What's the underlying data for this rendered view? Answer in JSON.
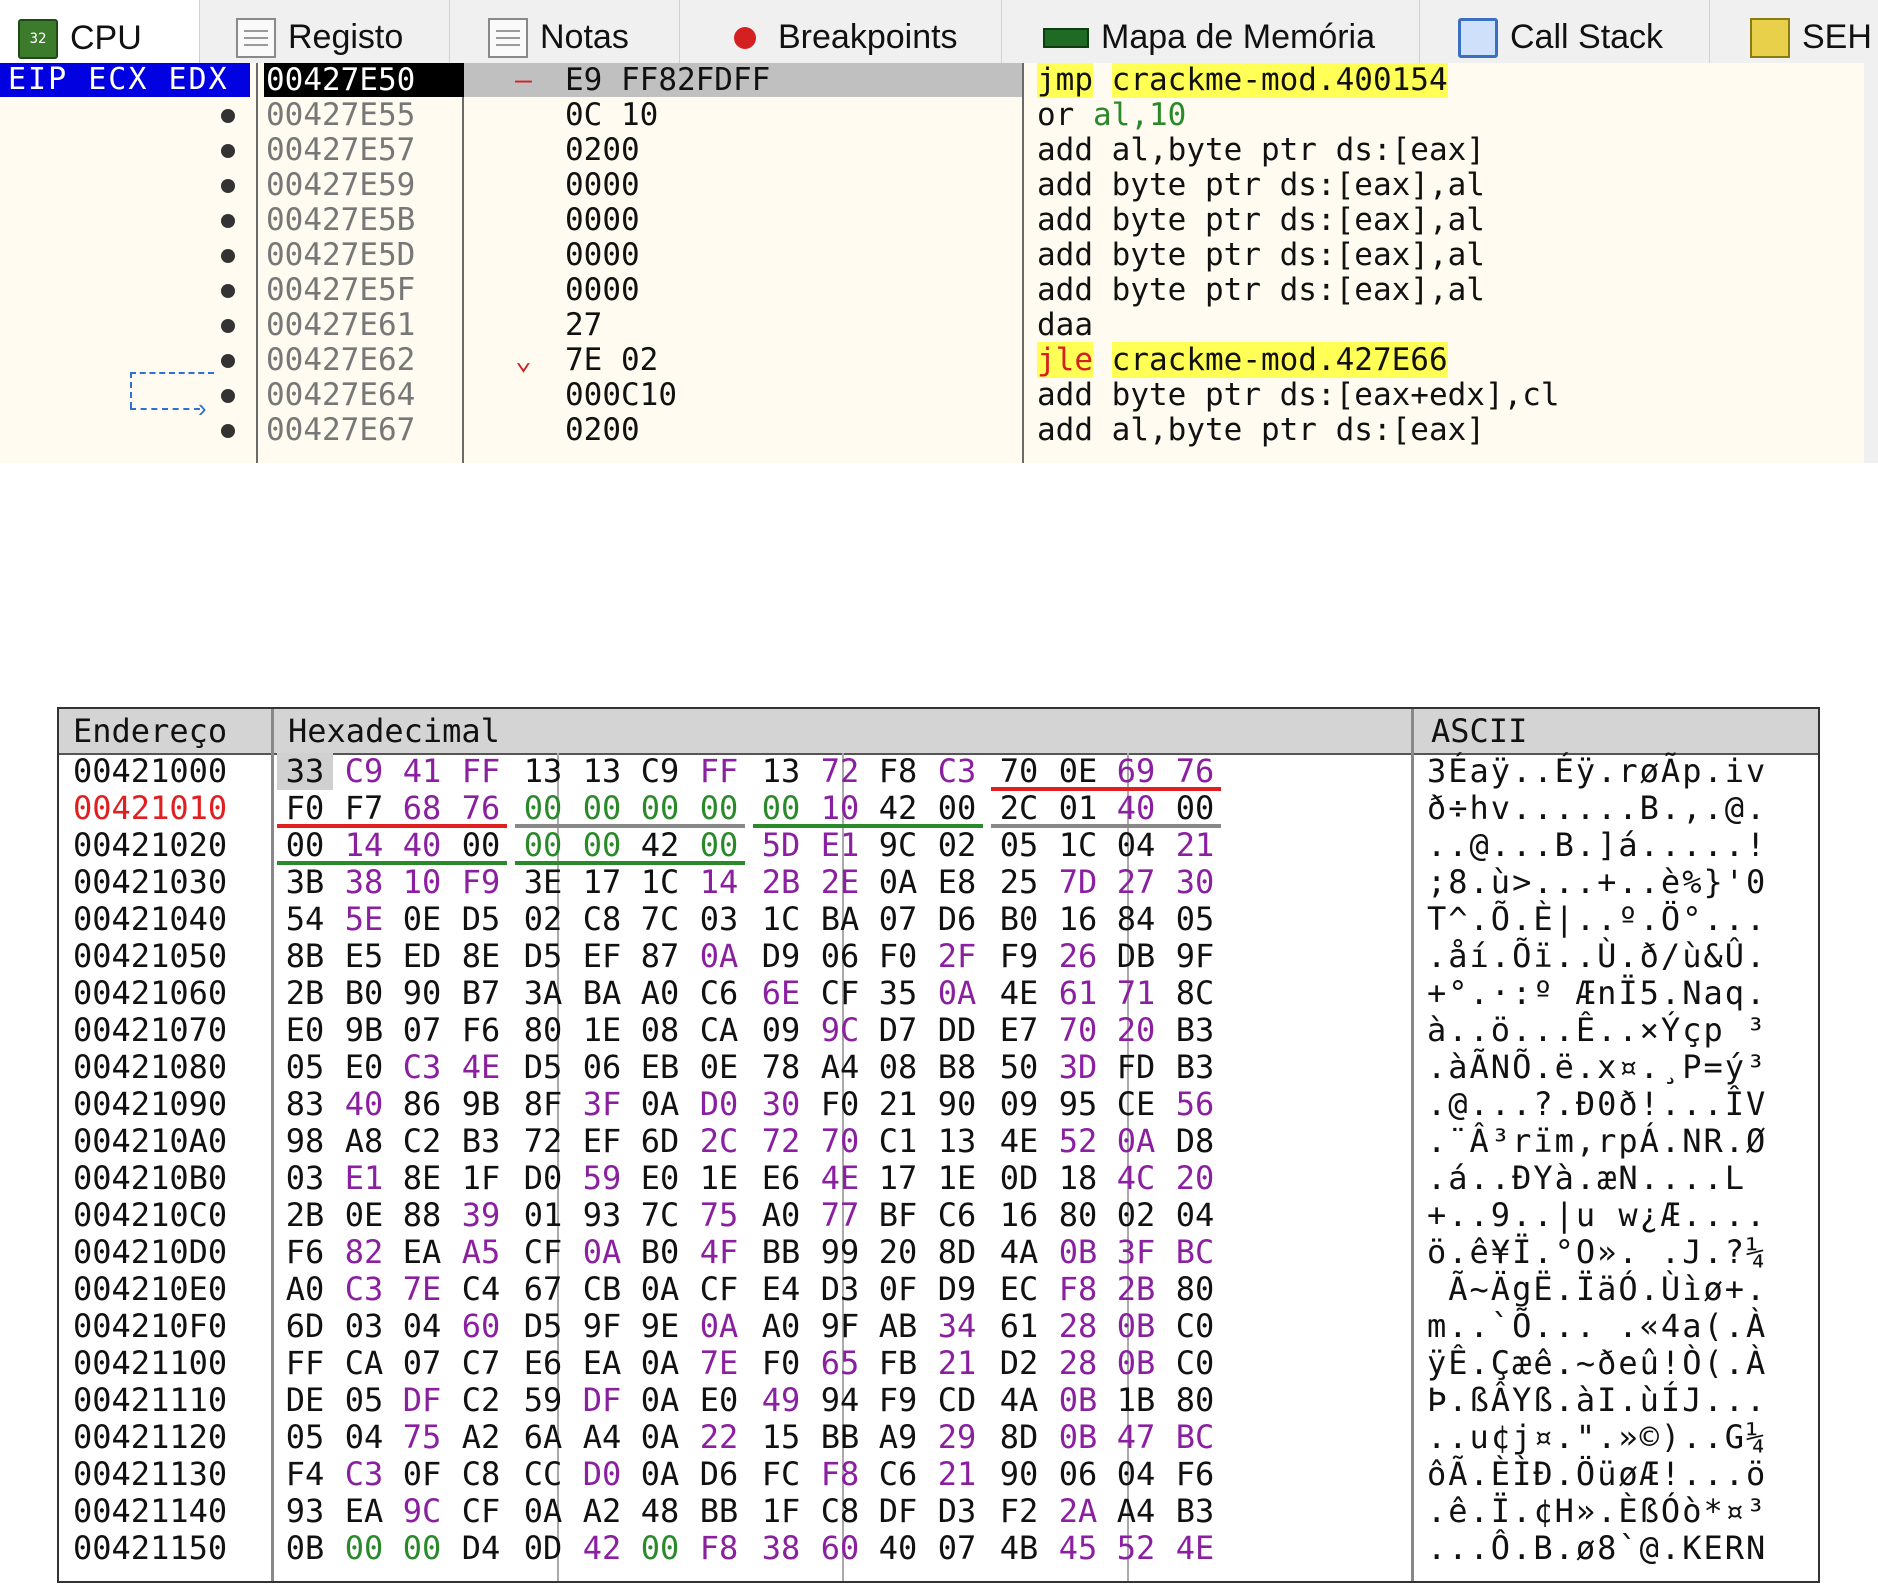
{
  "tabs": [
    {
      "label": "CPU",
      "icon": "cpu-32-icon",
      "active": true
    },
    {
      "label": "Registo",
      "icon": "log-icon"
    },
    {
      "label": "Notas",
      "icon": "notes-icon"
    },
    {
      "label": "Breakpoints",
      "icon": "breakpoint-icon"
    },
    {
      "label": "Mapa de Memória",
      "icon": "memory-map-icon"
    },
    {
      "label": "Call Stack",
      "icon": "call-stack-icon"
    },
    {
      "label": "SEH",
      "icon": "seh-icon"
    }
  ],
  "disasm": {
    "registers_label": "EIP ECX EDX",
    "rows": [
      {
        "addr": "00427E50",
        "bytes": "E9 FF82FDFF",
        "mnemonic": "jmp",
        "operands": "crackme-mod.400154",
        "current": true
      },
      {
        "addr": "00427E55",
        "bytes": "0C 10",
        "mnemonic": "or",
        "operands": "al,10"
      },
      {
        "addr": "00427E57",
        "bytes": "0200",
        "mnemonic": "add",
        "operands": "al,byte ptr ds:[eax]"
      },
      {
        "addr": "00427E59",
        "bytes": "0000",
        "mnemonic": "add",
        "operands": "byte ptr ds:[eax],al"
      },
      {
        "addr": "00427E5B",
        "bytes": "0000",
        "mnemonic": "add",
        "operands": "byte ptr ds:[eax],al"
      },
      {
        "addr": "00427E5D",
        "bytes": "0000",
        "mnemonic": "add",
        "operands": "byte ptr ds:[eax],al"
      },
      {
        "addr": "00427E5F",
        "bytes": "0000",
        "mnemonic": "add",
        "operands": "byte ptr ds:[eax],al"
      },
      {
        "addr": "00427E61",
        "bytes": "27",
        "mnemonic": "daa",
        "operands": ""
      },
      {
        "addr": "00427E62",
        "bytes": "7E 02",
        "mnemonic": "jle",
        "operands": "crackme-mod.427E66"
      },
      {
        "addr": "00427E64",
        "bytes": "000C10",
        "mnemonic": "add",
        "operands": "byte ptr ds:[eax+edx],cl"
      },
      {
        "addr": "00427E67",
        "bytes": "0200",
        "mnemonic": "add",
        "operands": "al,byte ptr ds:[eax]"
      }
    ]
  },
  "dump": {
    "headers": {
      "address": "Endereço",
      "hex": "Hexadecimal",
      "ascii": "ASCII"
    },
    "rows": [
      {
        "addr": "00421000",
        "bytes": [
          "33",
          "C9",
          "41",
          "FF",
          "13",
          "13",
          "C9",
          "FF",
          "13",
          "72",
          "F8",
          "C3",
          "70",
          "0E",
          "69",
          "76"
        ],
        "ascii": "3Éaÿ..Éÿ.røÃp.iv"
      },
      {
        "addr": "00421010",
        "bytes": [
          "F0",
          "F7",
          "68",
          "76",
          "00",
          "00",
          "00",
          "00",
          "00",
          "10",
          "42",
          "00",
          "2C",
          "01",
          "40",
          "00"
        ],
        "ascii": "ð÷hv......B.,.@.",
        "red": true
      },
      {
        "addr": "00421020",
        "bytes": [
          "00",
          "14",
          "40",
          "00",
          "00",
          "00",
          "42",
          "00",
          "5D",
          "E1",
          "9C",
          "02",
          "05",
          "1C",
          "04",
          "21"
        ],
        "ascii": "..@...B.]á.....!"
      },
      {
        "addr": "00421030",
        "bytes": [
          "3B",
          "38",
          "10",
          "F9",
          "3E",
          "17",
          "1C",
          "14",
          "2B",
          "2E",
          "0A",
          "E8",
          "25",
          "7D",
          "27",
          "30"
        ],
        "ascii": ";8.ù>...+..è%}'0"
      },
      {
        "addr": "00421040",
        "bytes": [
          "54",
          "5E",
          "0E",
          "D5",
          "02",
          "C8",
          "7C",
          "03",
          "1C",
          "BA",
          "07",
          "D6",
          "B0",
          "16",
          "84",
          "05"
        ],
        "ascii": "T^.Õ.È|..º.Ö°..."
      },
      {
        "addr": "00421050",
        "bytes": [
          "8B",
          "E5",
          "ED",
          "8E",
          "D5",
          "EF",
          "87",
          "0A",
          "D9",
          "06",
          "F0",
          "2F",
          "F9",
          "26",
          "DB",
          "9F"
        ],
        "ascii": ".åí.Õï..Ù.ð/ù&Û."
      },
      {
        "addr": "00421060",
        "bytes": [
          "2B",
          "B0",
          "90",
          "B7",
          "3A",
          "BA",
          "A0",
          "C6",
          "6E",
          "CF",
          "35",
          "0A",
          "4E",
          "61",
          "71",
          "8C"
        ],
        "ascii": "+°.·:º ÆnÏ5.Naq."
      },
      {
        "addr": "00421070",
        "bytes": [
          "E0",
          "9B",
          "07",
          "F6",
          "80",
          "1E",
          "08",
          "CA",
          "09",
          "9C",
          "D7",
          "DD",
          "E7",
          "70",
          "20",
          "B3"
        ],
        "ascii": "à..ö...Ê..×Ýçp ³"
      },
      {
        "addr": "00421080",
        "bytes": [
          "05",
          "E0",
          "C3",
          "4E",
          "D5",
          "06",
          "EB",
          "0E",
          "78",
          "A4",
          "08",
          "B8",
          "50",
          "3D",
          "FD",
          "B3"
        ],
        "ascii": ".àÃNÕ.ë.x¤.¸P=ý³"
      },
      {
        "addr": "00421090",
        "bytes": [
          "83",
          "40",
          "86",
          "9B",
          "8F",
          "3F",
          "0A",
          "D0",
          "30",
          "F0",
          "21",
          "90",
          "09",
          "95",
          "CE",
          "56"
        ],
        "ascii": ".@...?.Ð0ð!...ÎV"
      },
      {
        "addr": "004210A0",
        "bytes": [
          "98",
          "A8",
          "C2",
          "B3",
          "72",
          "EF",
          "6D",
          "2C",
          "72",
          "70",
          "C1",
          "13",
          "4E",
          "52",
          "0A",
          "D8"
        ],
        "ascii": ".¨Â³rïm,rpÁ.NR.Ø"
      },
      {
        "addr": "004210B0",
        "bytes": [
          "03",
          "E1",
          "8E",
          "1F",
          "D0",
          "59",
          "E0",
          "1E",
          "E6",
          "4E",
          "17",
          "1E",
          "0D",
          "18",
          "4C",
          "20"
        ],
        "ascii": ".á..ÐYà.æN....L "
      },
      {
        "addr": "004210C0",
        "bytes": [
          "2B",
          "0E",
          "88",
          "39",
          "01",
          "93",
          "7C",
          "75",
          "A0",
          "77",
          "BF",
          "C6",
          "16",
          "80",
          "02",
          "04"
        ],
        "ascii": "+..9..|u w¿Æ...."
      },
      {
        "addr": "004210D0",
        "bytes": [
          "F6",
          "82",
          "EA",
          "A5",
          "CF",
          "0A",
          "B0",
          "4F",
          "BB",
          "99",
          "20",
          "8D",
          "4A",
          "0B",
          "3F",
          "BC"
        ],
        "ascii": "ö.ê¥Ï.°O». .J.?¼"
      },
      {
        "addr": "004210E0",
        "bytes": [
          "A0",
          "C3",
          "7E",
          "C4",
          "67",
          "CB",
          "0A",
          "CF",
          "E4",
          "D3",
          "0F",
          "D9",
          "EC",
          "F8",
          "2B",
          "80"
        ],
        "ascii": " Ã~ÄgË.ÏäÓ.Ùìø+."
      },
      {
        "addr": "004210F0",
        "bytes": [
          "6D",
          "03",
          "04",
          "60",
          "D5",
          "9F",
          "9E",
          "0A",
          "A0",
          "9F",
          "AB",
          "34",
          "61",
          "28",
          "0B",
          "C0"
        ],
        "ascii": "m..`Õ... .«4a(.À"
      },
      {
        "addr": "00421100",
        "bytes": [
          "FF",
          "CA",
          "07",
          "C7",
          "E6",
          "EA",
          "0A",
          "7E",
          "F0",
          "65",
          "FB",
          "21",
          "D2",
          "28",
          "0B",
          "C0"
        ],
        "ascii": "ÿÊ.Çæê.~ðeû!Ò(.À"
      },
      {
        "addr": "00421110",
        "bytes": [
          "DE",
          "05",
          "DF",
          "C2",
          "59",
          "DF",
          "0A",
          "E0",
          "49",
          "94",
          "F9",
          "CD",
          "4A",
          "0B",
          "1B",
          "80"
        ],
        "ascii": "Þ.ßÂYß.àI.ùÍJ..."
      },
      {
        "addr": "00421120",
        "bytes": [
          "05",
          "04",
          "75",
          "A2",
          "6A",
          "A4",
          "0A",
          "22",
          "15",
          "BB",
          "A9",
          "29",
          "8D",
          "0B",
          "47",
          "BC"
        ],
        "ascii": "..u¢j¤.\".»©)..G¼"
      },
      {
        "addr": "00421130",
        "bytes": [
          "F4",
          "C3",
          "0F",
          "C8",
          "CC",
          "D0",
          "0A",
          "D6",
          "FC",
          "F8",
          "C6",
          "21",
          "90",
          "06",
          "04",
          "F6"
        ],
        "ascii": "ôÃ.ÈÌÐ.ÖüøÆ!...ö"
      },
      {
        "addr": "00421140",
        "bytes": [
          "93",
          "EA",
          "9C",
          "CF",
          "0A",
          "A2",
          "48",
          "BB",
          "1F",
          "C8",
          "DF",
          "D3",
          "F2",
          "2A",
          "A4",
          "B3"
        ],
        "ascii": ".ê.Ï.¢H».ÈßÓò*¤³"
      },
      {
        "addr": "00421150",
        "bytes": [
          "0B",
          "00",
          "00",
          "D4",
          "0D",
          "42",
          "00",
          "F8",
          "38",
          "60",
          "40",
          "07",
          "4B",
          "45",
          "52",
          "4E"
        ],
        "ascii": "...Ô.B.ø8`@.KERN"
      }
    ]
  }
}
